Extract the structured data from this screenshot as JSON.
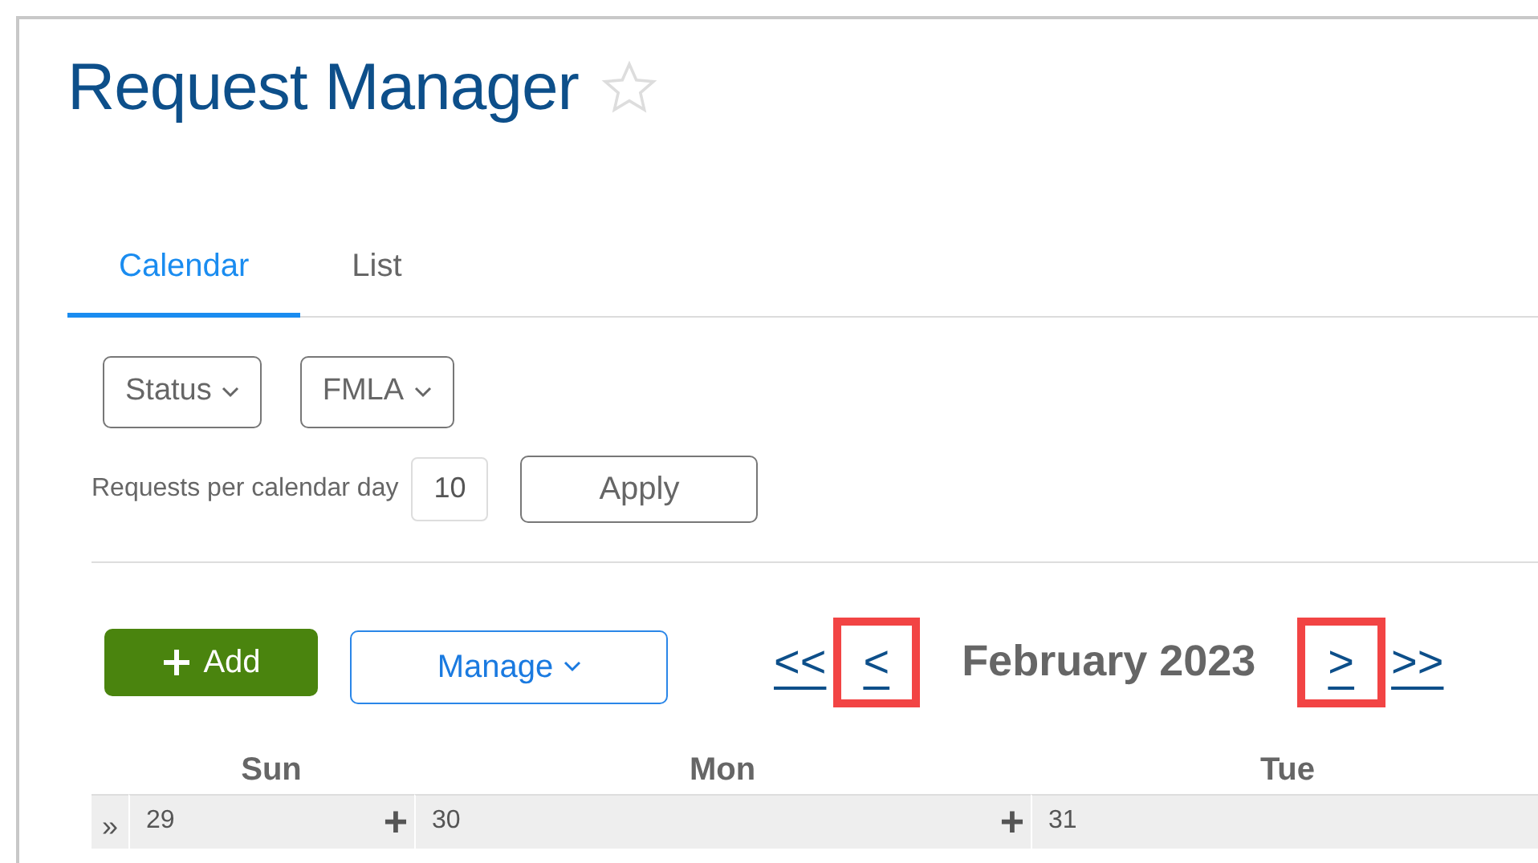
{
  "title": "Request Manager",
  "favorite": false,
  "tabs": [
    {
      "label": "Calendar",
      "selected": true
    },
    {
      "label": "List",
      "selected": false
    }
  ],
  "filters": [
    {
      "label": "Status"
    },
    {
      "label": "FMLA"
    }
  ],
  "per_day": {
    "label": "Requests per calendar day",
    "value": "10"
  },
  "apply_button": "Apply",
  "add_button": "Add",
  "manage_button": "Manage",
  "navigation": [
    {
      "label": "<<",
      "highlighted": false
    },
    {
      "label": "<",
      "highlighted": true
    },
    {
      "label": "February 2023",
      "kind": "month"
    },
    {
      "label": ">",
      "highlighted": true
    },
    {
      "label": ">>",
      "highlighted": false
    }
  ],
  "calendar": {
    "expand_glyph": "»",
    "days": [
      {
        "name": "Sun",
        "date": "29",
        "add": "+"
      },
      {
        "name": "Mon",
        "date": "30",
        "add": "+"
      },
      {
        "name": "Tue",
        "date": "31"
      }
    ]
  }
}
